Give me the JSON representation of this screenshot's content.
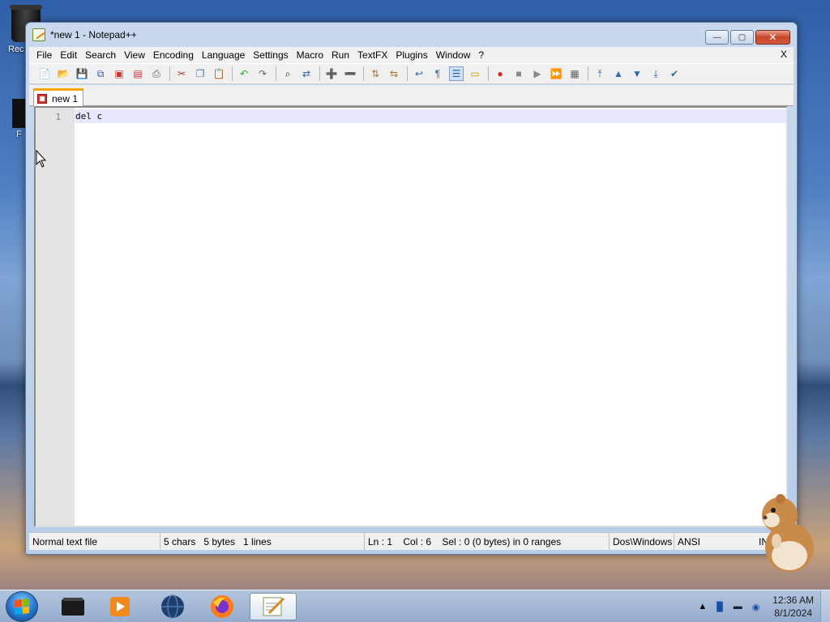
{
  "desktop": {
    "icons": [
      {
        "label": "Rec",
        "icon": "recycle-bin-icon"
      },
      {
        "label": "F",
        "icon": "folder-icon"
      }
    ]
  },
  "window": {
    "title": "*new 1 - Notepad++",
    "controls": {
      "minimize": "—",
      "maximize": "▢",
      "close": "✕"
    }
  },
  "menubar": {
    "items": [
      "File",
      "Edit",
      "Search",
      "View",
      "Encoding",
      "Language",
      "Settings",
      "Macro",
      "Run",
      "TextFX",
      "Plugins",
      "Window",
      "?"
    ],
    "close_label": "X"
  },
  "toolbar": {
    "icons": [
      "new-file-icon",
      "open-file-icon",
      "save-icon",
      "save-all-icon",
      "close-icon",
      "close-all-icon",
      "print-icon",
      "cut-icon",
      "copy-icon",
      "paste-icon",
      "undo-icon",
      "redo-icon",
      "find-icon",
      "replace-icon",
      "zoom-in-icon",
      "zoom-out-icon",
      "sync-vertical-icon",
      "sync-horizontal-icon",
      "word-wrap-icon",
      "show-all-chars-icon",
      "indent-guide-icon",
      "user-lang-icon",
      "record-macro-icon",
      "stop-macro-icon",
      "play-macro-icon",
      "run-macro-multiple-icon",
      "save-macro-icon",
      "top-icon",
      "up-icon",
      "down-icon",
      "bottom-icon",
      "spellcheck-icon"
    ]
  },
  "tabs": [
    {
      "label": "new 1",
      "modified": true
    }
  ],
  "editor": {
    "line_number": "1",
    "content": "del c"
  },
  "statusbar": {
    "file_type": "Normal text file",
    "stats": "5 chars   5 bytes   1 lines",
    "position": "Ln : 1    Col : 6    Sel : 0 (0 bytes) in 0 ranges",
    "eol": "Dos\\Windows",
    "encoding": "ANSI",
    "mode": "INS"
  },
  "taskbar": {
    "apps": [
      "terminal-icon",
      "media-player-icon",
      "browser-globe-icon",
      "firefox-icon",
      "notepad-plus-plus-icon"
    ],
    "active_app": "notepad-plus-plus-icon",
    "clock": {
      "time": "12:36 AM",
      "date": "8/1/2024"
    }
  }
}
